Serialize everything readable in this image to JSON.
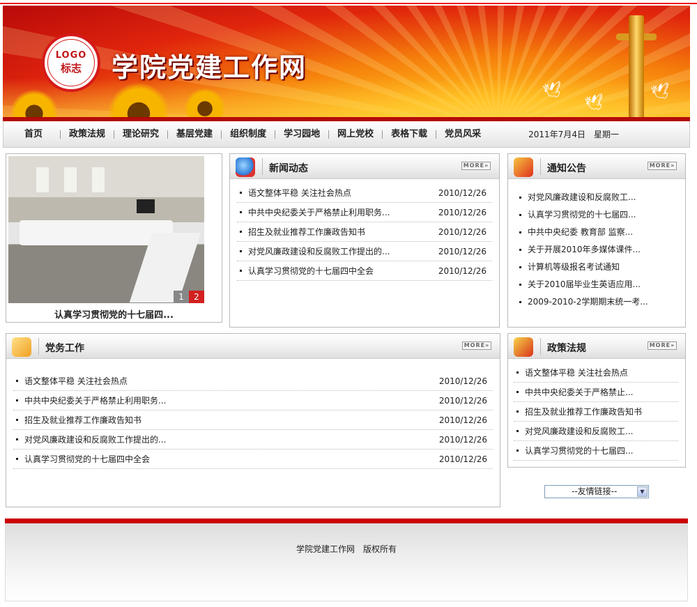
{
  "header": {
    "site_title": "学院党建工作网",
    "logo_text": "LOGO",
    "logo_sub": "标志"
  },
  "nav": {
    "items": [
      "首页",
      "政策法规",
      "理论研究",
      "基层党建",
      "组织制度",
      "学习园地",
      "网上党校",
      "表格下载",
      "党员风采"
    ],
    "date": "2011年7月4日　星期一"
  },
  "slideshow": {
    "caption": "认真学习贯彻党的十七届四...",
    "pages": [
      "1",
      "2"
    ],
    "active_page": 2
  },
  "news": {
    "title": "新闻动态",
    "more": "MORE»",
    "items": [
      {
        "title": "语文整体平稳 关注社会热点",
        "date": "2010/12/26"
      },
      {
        "title": "中共中央纪委关于严格禁止利用职务...",
        "date": "2010/12/26"
      },
      {
        "title": "招生及就业推荐工作廉政告知书",
        "date": "2010/12/26"
      },
      {
        "title": "对党风廉政建设和反腐败工作提出的...",
        "date": "2010/12/26"
      },
      {
        "title": "认真学习贯彻党的十七届四中全会",
        "date": "2010/12/26"
      }
    ]
  },
  "notice": {
    "title": "通知公告",
    "more": "MORE»",
    "items": [
      "对党风廉政建设和反腐败工...",
      "认真学习贯彻党的十七届四...",
      "中共中央纪委 教育部 监察...",
      "关于开展2010年多媒体课件...",
      "计算机等级报名考试通知",
      "关于2010届毕业生英语应用...",
      "2009-2010-2学期期末统一考..."
    ]
  },
  "party": {
    "title": "党务工作",
    "more": "MORE»",
    "items": [
      {
        "title": "语文整体平稳 关注社会热点",
        "date": "2010/12/26"
      },
      {
        "title": "中共中央纪委关于严格禁止利用职务...",
        "date": "2010/12/26"
      },
      {
        "title": "招生及就业推荐工作廉政告知书",
        "date": "2010/12/26"
      },
      {
        "title": "对党风廉政建设和反腐败工作提出的...",
        "date": "2010/12/26"
      },
      {
        "title": "认真学习贯彻党的十七届四中全会",
        "date": "2010/12/26"
      }
    ]
  },
  "policy": {
    "title": "政策法规",
    "more": "MORE»",
    "items": [
      "语文整体平稳 关注社会热点",
      "中共中央纪委关于严格禁止...",
      "招生及就业推荐工作廉政告知书",
      "对党风廉政建设和反腐败工...",
      "认真学习贯彻党的十七届四..."
    ]
  },
  "links_select": {
    "value": "--友情链接--"
  },
  "footer": {
    "copyright": "学院党建工作网　版权所有"
  },
  "colors": {
    "brand_red": "#cc0000",
    "banner_orange": "#f57d0b"
  }
}
